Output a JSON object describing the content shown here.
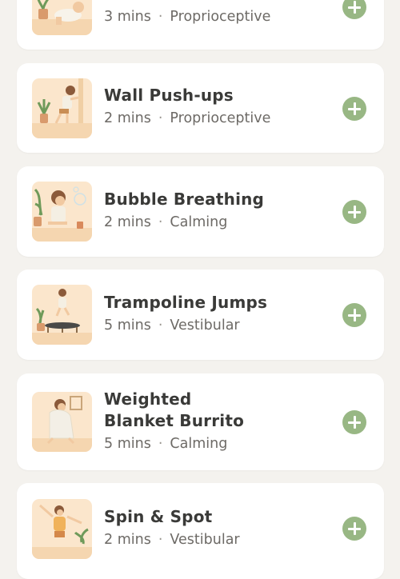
{
  "activities": [
    {
      "title": "",
      "duration": "3 mins",
      "category": "Proprioceptive",
      "icon": "crawling-child-illustration"
    },
    {
      "title": "Wall Push-ups",
      "duration": "2 mins",
      "category": "Proprioceptive",
      "icon": "wall-pushup-illustration"
    },
    {
      "title": "Bubble Breathing",
      "duration": "2 mins",
      "category": "Calming",
      "icon": "bubble-breathing-illustration"
    },
    {
      "title": "Trampoline Jumps",
      "duration": "5 mins",
      "category": "Vestibular",
      "icon": "trampoline-illustration"
    },
    {
      "title_line1": "Weighted",
      "title_line2": "Blanket Burrito",
      "duration": "5 mins",
      "category": "Calming",
      "icon": "blanket-burrito-illustration"
    },
    {
      "title": "Spin & Spot",
      "duration": "2 mins",
      "category": "Vestibular",
      "icon": "spinning-child-illustration"
    }
  ],
  "separator": "·",
  "colors": {
    "accent": "#98b784",
    "thumb_bg": "#fbe6cc",
    "page_bg": "#f4f2ee"
  }
}
